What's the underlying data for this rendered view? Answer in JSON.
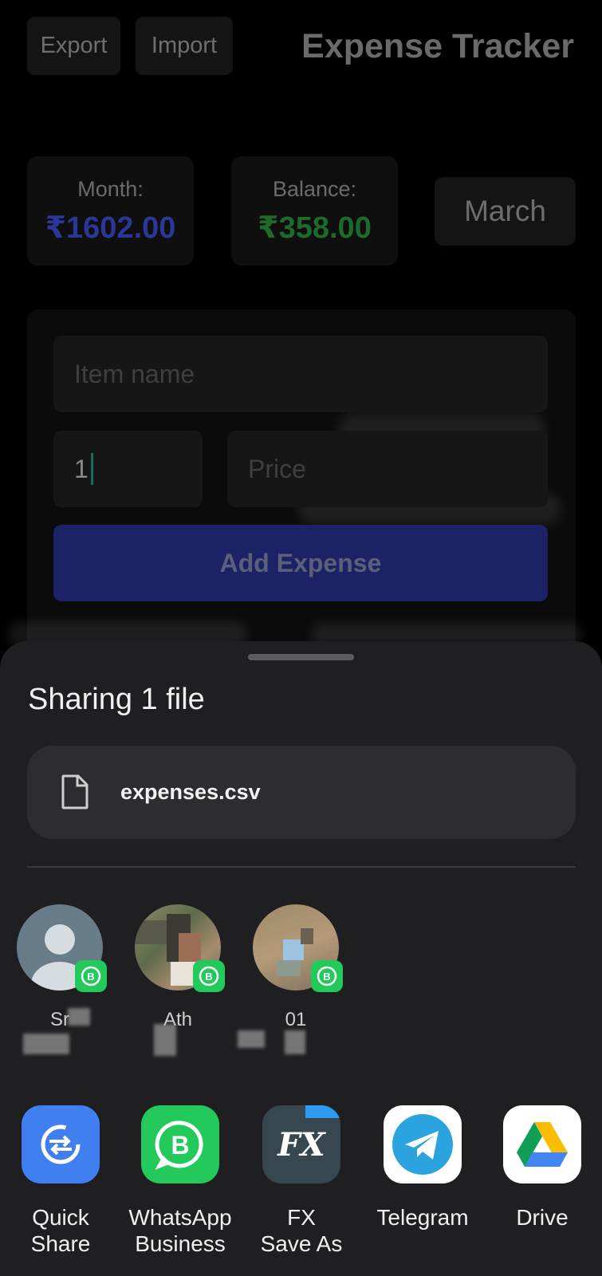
{
  "app": {
    "title": "Expense Tracker",
    "export_label": "Export",
    "import_label": "Import",
    "month_label": "Month:",
    "month_value": "₹1602.00",
    "balance_label": "Balance:",
    "balance_value": "₹358.00",
    "month_select": "March",
    "item_placeholder": "Item name",
    "quantity_value": "1",
    "price_placeholder": "Price",
    "add_button": "Add Expense"
  },
  "colors": {
    "month_value": "#2a3796",
    "balance_value": "#1d6b2a",
    "sheet_bg": "#1f1f21",
    "whatsapp_business": "#24c95c"
  },
  "share_sheet": {
    "title": "Sharing 1 file",
    "file_name": "expenses.csv",
    "contacts": [
      {
        "name": "Sr",
        "icon": "person-icon"
      },
      {
        "name": "Ath",
        "icon": "photo-avatar"
      },
      {
        "name": "01",
        "icon": "photo-avatar"
      }
    ],
    "apps": [
      {
        "line1": "Quick",
        "line2": "Share",
        "icon": "quick-share-icon"
      },
      {
        "line1": "WhatsApp",
        "line2": "Business",
        "icon": "whatsapp-business-icon"
      },
      {
        "line1": "FX",
        "line2": "Save As",
        "icon": "fx-icon"
      },
      {
        "line1": "Telegram",
        "line2": "",
        "icon": "telegram-icon"
      },
      {
        "line1": "Drive",
        "line2": "",
        "icon": "google-drive-icon"
      }
    ]
  }
}
